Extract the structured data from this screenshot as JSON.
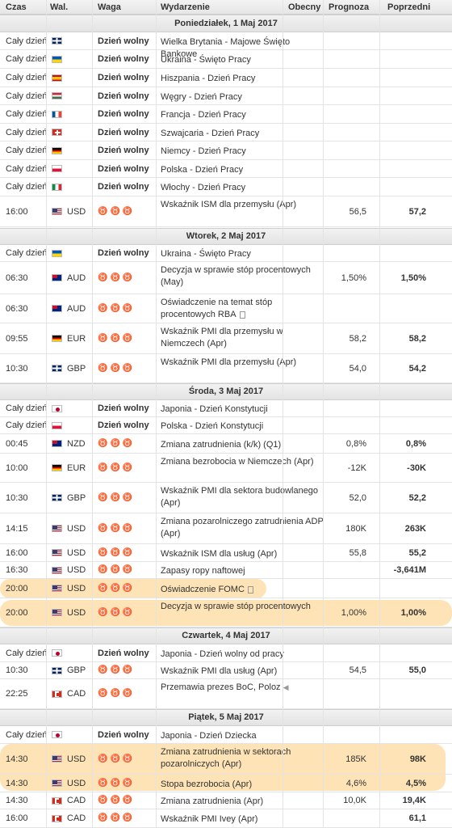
{
  "header": {
    "time": "Czas",
    "currency": "Wal.",
    "importance": "Waga",
    "event": "Wydarzenie",
    "actual": "Obecny",
    "forecast": "Prognoza",
    "previous": "Poprzedni"
  },
  "days": [
    {
      "label": "Poniedziałek, 1 Maj 2017"
    },
    {
      "label": "Wtorek, 2 Maj 2017"
    },
    {
      "label": "Środa, 3 Maj 2017"
    },
    {
      "label": "Czwartek, 4 Maj 2017"
    },
    {
      "label": "Piątek, 5 Maj 2017"
    }
  ],
  "rows": [
    {
      "time": "Cały dzień",
      "flag": "uk",
      "currency": "",
      "importance": "Dzień wolny",
      "event": "Wielka Brytania - Majowe Święto Bankowe",
      "forecast": "",
      "previous": ""
    },
    {
      "time": "Cały dzień",
      "flag": "ukraine",
      "currency": "",
      "importance": "Dzień wolny",
      "event": "Ukraina - Święto Pracy",
      "forecast": "",
      "previous": ""
    },
    {
      "time": "Cały dzień",
      "flag": "spain",
      "currency": "",
      "importance": "Dzień wolny",
      "event": "Hiszpania - Dzień Pracy",
      "forecast": "",
      "previous": ""
    },
    {
      "time": "Cały dzień",
      "flag": "hungary",
      "currency": "",
      "importance": "Dzień wolny",
      "event": "Węgry - Dzień Pracy",
      "forecast": "",
      "previous": ""
    },
    {
      "time": "Cały dzień",
      "flag": "france",
      "currency": "",
      "importance": "Dzień wolny",
      "event": "Francja - Dzień Pracy",
      "forecast": "",
      "previous": ""
    },
    {
      "time": "Cały dzień",
      "flag": "switzerland",
      "currency": "",
      "importance": "Dzień wolny",
      "event": "Szwajcaria - Dzień Pracy",
      "forecast": "",
      "previous": ""
    },
    {
      "time": "Cały dzień",
      "flag": "germany",
      "currency": "",
      "importance": "Dzień wolny",
      "event": "Niemcy - Dzień Pracy",
      "forecast": "",
      "previous": ""
    },
    {
      "time": "Cały dzień",
      "flag": "poland",
      "currency": "",
      "importance": "Dzień wolny",
      "event": "Polska - Dzień Pracy",
      "forecast": "",
      "previous": ""
    },
    {
      "time": "Cały dzień",
      "flag": "italy",
      "currency": "",
      "importance": "Dzień wolny",
      "event": "Włochy - Dzień Pracy",
      "forecast": "",
      "previous": ""
    },
    {
      "time": "16:00",
      "flag": "usa",
      "currency": "USD",
      "importance": "",
      "event": "Wskaźnik ISM dla przemysłu (Apr)",
      "forecast": "56,5",
      "previous": "57,2"
    },
    {
      "time": "Cały dzień",
      "flag": "ukraine",
      "currency": "",
      "importance": "Dzień wolny",
      "event": "Ukraina - Święto Pracy",
      "forecast": "",
      "previous": ""
    },
    {
      "time": "06:30",
      "flag": "australia",
      "currency": "AUD",
      "importance": "",
      "event": "Decyzja w sprawie stóp procentowych (May)",
      "forecast": "1,50%",
      "previous": "1,50%"
    },
    {
      "time": "06:30",
      "flag": "australia",
      "currency": "AUD",
      "importance": "",
      "event": "Oświadczenie na temat stóp procentowych RBA",
      "forecast": "",
      "previous": ""
    },
    {
      "time": "09:55",
      "flag": "germany",
      "currency": "EUR",
      "importance": "",
      "event": "Wskaźnik PMI dla przemysłu w Niemczech (Apr)",
      "forecast": "58,2",
      "previous": "58,2"
    },
    {
      "time": "10:30",
      "flag": "uk",
      "currency": "GBP",
      "importance": "",
      "event": "Wskaźnik PMI dla przemysłu (Apr)",
      "forecast": "54,0",
      "previous": "54,2"
    },
    {
      "time": "Cały dzień",
      "flag": "japan",
      "currency": "",
      "importance": "Dzień wolny",
      "event": "Japonia - Dzień Konstytucji",
      "forecast": "",
      "previous": ""
    },
    {
      "time": "Cały dzień",
      "flag": "poland",
      "currency": "",
      "importance": "Dzień wolny",
      "event": "Polska - Dzień Konstytucji",
      "forecast": "",
      "previous": ""
    },
    {
      "time": "00:45",
      "flag": "nz",
      "currency": "NZD",
      "importance": "",
      "event": "Zmiana zatrudnienia (k/k) (Q1)",
      "forecast": "0,8%",
      "previous": "0,8%"
    },
    {
      "time": "10:00",
      "flag": "germany",
      "currency": "EUR",
      "importance": "",
      "event": "Zmiana bezrobocia w Niemczech (Apr)",
      "forecast": "-12K",
      "previous": "-30K"
    },
    {
      "time": "10:30",
      "flag": "uk",
      "currency": "GBP",
      "importance": "",
      "event": "Wskaźnik PMI dla sektora budowlanego (Apr)",
      "forecast": "52,0",
      "previous": "52,2"
    },
    {
      "time": "14:15",
      "flag": "usa",
      "currency": "USD",
      "importance": "",
      "event": "Zmiana pozarolniczego zatrudnienia ADP (Apr)",
      "forecast": "180K",
      "previous": "263K"
    },
    {
      "time": "16:00",
      "flag": "usa",
      "currency": "USD",
      "importance": "",
      "event": "Wskaźnik ISM dla usług (Apr)",
      "forecast": "55,8",
      "previous": "55,2"
    },
    {
      "time": "16:30",
      "flag": "usa",
      "currency": "USD",
      "importance": "",
      "event": "Zapasy ropy naftowej",
      "forecast": "",
      "previous": "-3,641M"
    },
    {
      "time": "20:00",
      "flag": "usa",
      "currency": "USD",
      "importance": "",
      "event": "Oświadczenie FOMC",
      "forecast": "",
      "previous": ""
    },
    {
      "time": "20:00",
      "flag": "usa",
      "currency": "USD",
      "importance": "",
      "event": "Decyzja w sprawie stóp procentowych",
      "forecast": "1,00%",
      "previous": "1,00%"
    },
    {
      "time": "Cały dzień",
      "flag": "japan",
      "currency": "",
      "importance": "Dzień wolny",
      "event": "Japonia - Dzień wolny od pracy",
      "forecast": "",
      "previous": ""
    },
    {
      "time": "10:30",
      "flag": "uk",
      "currency": "GBP",
      "importance": "",
      "event": "Wskaźnik PMI dla usług (Apr)",
      "forecast": "54,5",
      "previous": "55,0"
    },
    {
      "time": "22:25",
      "flag": "canada",
      "currency": "CAD",
      "importance": "",
      "event": "Przemawia prezes BoC, Poloz",
      "forecast": "",
      "previous": ""
    },
    {
      "time": "Cały dzień",
      "flag": "japan",
      "currency": "",
      "importance": "Dzień wolny",
      "event": "Japonia - Dzień Dziecka",
      "forecast": "",
      "previous": ""
    },
    {
      "time": "14:30",
      "flag": "usa",
      "currency": "USD",
      "importance": "",
      "event": "Zmiana zatrudnienia w sektorach pozarolniczych (Apr)",
      "forecast": "185K",
      "previous": "98K"
    },
    {
      "time": "14:30",
      "flag": "usa",
      "currency": "USD",
      "importance": "",
      "event": "Stopa bezrobocia (Apr)",
      "forecast": "4,6%",
      "previous": "4,5%"
    },
    {
      "time": "14:30",
      "flag": "canada",
      "currency": "CAD",
      "importance": "",
      "event": "Zmiana zatrudnienia (Apr)",
      "forecast": "10,0K",
      "previous": "19,4K"
    },
    {
      "time": "16:00",
      "flag": "canada",
      "currency": "CAD",
      "importance": "",
      "event": "Wskaźnik PMI Ivey (Apr)",
      "forecast": "",
      "previous": "61,1"
    }
  ]
}
